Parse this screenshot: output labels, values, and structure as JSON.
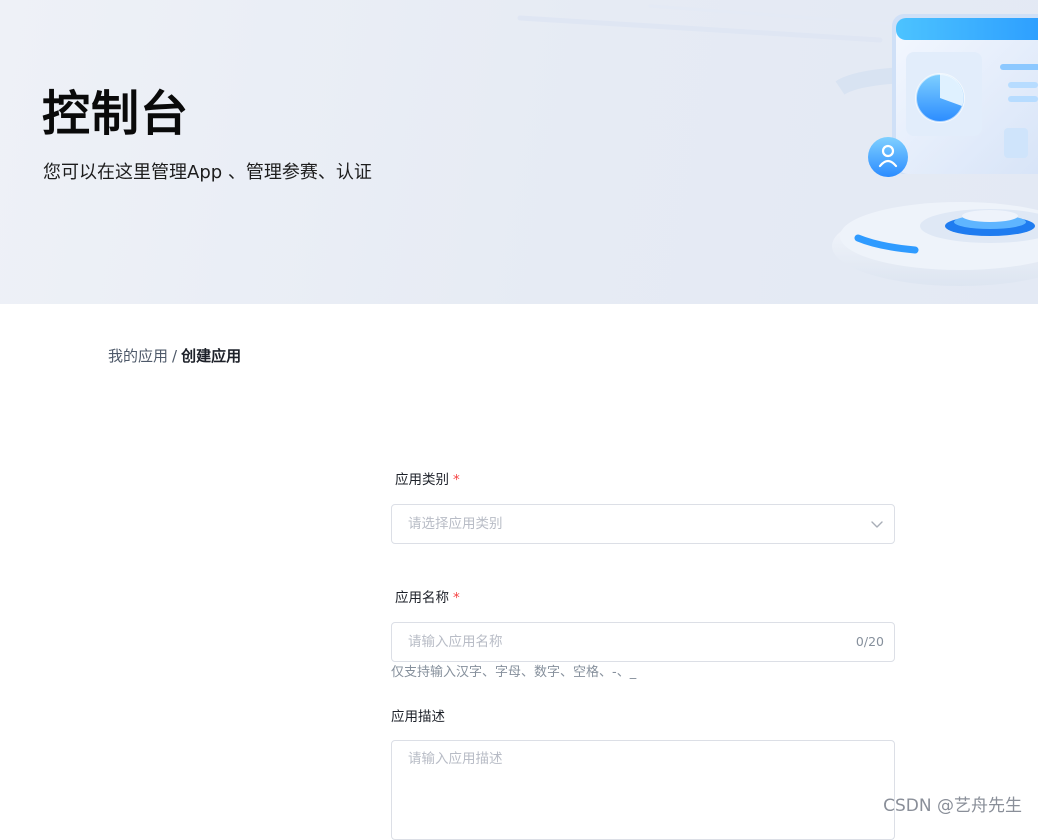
{
  "banner": {
    "title": "控制台",
    "subtitle": "您可以在这里管理App 、管理参赛、认证"
  },
  "breadcrumb": {
    "parent": "我的应用",
    "separator": "/",
    "current": "创建应用"
  },
  "form": {
    "category": {
      "label": "应用类别",
      "required_mark": "*",
      "placeholder": "请选择应用类别"
    },
    "name": {
      "label": "应用名称",
      "required_mark": "*",
      "placeholder": "请输入应用名称",
      "counter": "0/20",
      "hint": "仅支持输入汉字、字母、数字、空格、-、_"
    },
    "description": {
      "label": "应用描述",
      "placeholder": "请输入应用描述"
    }
  },
  "watermark": "CSDN @艺舟先生",
  "colors": {
    "accent": "#1677ff",
    "required": "#f53f3f",
    "banner_bg": "#e6ebf4"
  }
}
